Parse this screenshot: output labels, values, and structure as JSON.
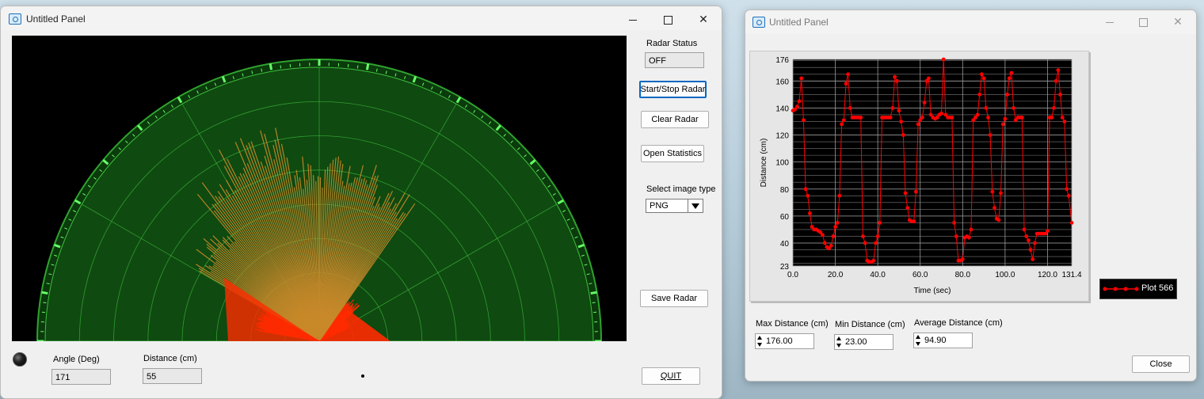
{
  "left_window": {
    "title": "Untitled Panel",
    "radar_status": {
      "label": "Radar Status",
      "value": "OFF"
    },
    "buttons": {
      "start_stop": "Start/Stop Radar",
      "clear": "Clear Radar",
      "statistics": "Open Statistics",
      "save": "Save Radar",
      "quit": "QUIT"
    },
    "image_type": {
      "label": "Select image type",
      "selected": "PNG"
    },
    "angle": {
      "label": "Angle (Deg)",
      "value": "171"
    },
    "distance": {
      "label": "Distance (cm)",
      "value": "55"
    }
  },
  "right_window": {
    "title": "Untitled Panel",
    "max_distance": {
      "label": "Max Distance (cm)",
      "value": "176.00"
    },
    "min_distance": {
      "label": "Min Distance (cm)",
      "value": "23.00"
    },
    "avg_distance": {
      "label": "Average Distance (cm)",
      "value": "94.90"
    },
    "close_label": "Close"
  },
  "colors": {
    "radar_bg": "#000000",
    "radar_field": "#0f4a10",
    "radar_grid": "#3fbf3f",
    "radar_rim": "#2fa32f",
    "radar_tick": "#66ff66",
    "echo_far": "#c98a2a",
    "echo_near": "#ff2a00",
    "plot_bg": "#000000",
    "plot_line": "#ff0000",
    "plot_grid": "#9a9a9a"
  },
  "radar": {
    "echo_angle_range_deg": [
      24,
      171
    ],
    "notes_on_data": "echo lengths per angle, cm"
  },
  "chart_data": {
    "type": "line",
    "xlabel": "Time (sec)",
    "ylabel": "Distance (cm)",
    "xlim": [
      0.0,
      131.4
    ],
    "ylim": [
      23,
      176
    ],
    "x_ticks": [
      "0.0",
      "20.0",
      "40.0",
      "60.0",
      "80.0",
      "100.0",
      "120.0",
      "131.4"
    ],
    "y_ticks": [
      "23",
      "40",
      "60",
      "80",
      "100",
      "120",
      "140",
      "160",
      "176"
    ],
    "grid": true,
    "legend": "right, outside plot area",
    "series": [
      {
        "name": "Plot 566",
        "color": "#ff0000",
        "marker": "circle",
        "points": [
          [
            0.0,
            138
          ],
          [
            1.0,
            139
          ],
          [
            2.0,
            141
          ],
          [
            3.0,
            145
          ],
          [
            4.0,
            162
          ],
          [
            5.0,
            131
          ],
          [
            6.0,
            80
          ],
          [
            7.0,
            75
          ],
          [
            8.0,
            62
          ],
          [
            9.0,
            52
          ],
          [
            10.0,
            50
          ],
          [
            11.0,
            50
          ],
          [
            12.0,
            49
          ],
          [
            13.0,
            48
          ],
          [
            14.0,
            46
          ],
          [
            15.0,
            40
          ],
          [
            16.0,
            37
          ],
          [
            17.0,
            36
          ],
          [
            18.0,
            38
          ],
          [
            19.0,
            45
          ],
          [
            20.0,
            52
          ],
          [
            21.0,
            55
          ],
          [
            22.0,
            75
          ],
          [
            23.0,
            128
          ],
          [
            24.0,
            131
          ],
          [
            25.0,
            158
          ],
          [
            26.0,
            165
          ],
          [
            27.0,
            140
          ],
          [
            28.0,
            133
          ],
          [
            29.0,
            133
          ],
          [
            30.0,
            133
          ],
          [
            31.0,
            133
          ],
          [
            32.0,
            133
          ],
          [
            33.0,
            45
          ],
          [
            34.0,
            40
          ],
          [
            35.0,
            27
          ],
          [
            36.0,
            26
          ],
          [
            37.0,
            26
          ],
          [
            38.0,
            27
          ],
          [
            39.0,
            40
          ],
          [
            40.0,
            45
          ],
          [
            41.0,
            55
          ],
          [
            42.0,
            133
          ],
          [
            43.0,
            133
          ],
          [
            44.0,
            133
          ],
          [
            45.0,
            133
          ],
          [
            46.0,
            133
          ],
          [
            47.0,
            140
          ],
          [
            48.0,
            163
          ],
          [
            49.0,
            160
          ],
          [
            50.0,
            138
          ],
          [
            51.0,
            130
          ],
          [
            52.0,
            120
          ],
          [
            53.0,
            77
          ],
          [
            54.0,
            66
          ],
          [
            55.0,
            57
          ],
          [
            56.0,
            56
          ],
          [
            57.0,
            56
          ],
          [
            58.0,
            78
          ],
          [
            59.0,
            128
          ],
          [
            60.0,
            131
          ],
          [
            61.0,
            133
          ],
          [
            62.0,
            144
          ],
          [
            63.0,
            160
          ],
          [
            64.0,
            162
          ],
          [
            65.0,
            135
          ],
          [
            66.0,
            133
          ],
          [
            67.0,
            132
          ],
          [
            68.0,
            133
          ],
          [
            69.0,
            135
          ],
          [
            70.0,
            136
          ],
          [
            71.0,
            176
          ],
          [
            72.0,
            135
          ],
          [
            73.0,
            133
          ],
          [
            74.0,
            133
          ],
          [
            75.0,
            133
          ],
          [
            76.0,
            55
          ],
          [
            77.0,
            45
          ],
          [
            78.0,
            27
          ],
          [
            79.0,
            27
          ],
          [
            80.0,
            28
          ],
          [
            81.0,
            44
          ],
          [
            82.0,
            45
          ],
          [
            83.0,
            44
          ],
          [
            84.0,
            50
          ],
          [
            85.0,
            131
          ],
          [
            86.0,
            133
          ],
          [
            87.0,
            135
          ],
          [
            88.0,
            150
          ],
          [
            89.0,
            165
          ],
          [
            90.0,
            162
          ],
          [
            91.0,
            140
          ],
          [
            92.0,
            133
          ],
          [
            93.0,
            120
          ],
          [
            94.0,
            78
          ],
          [
            95.0,
            66
          ],
          [
            96.0,
            58
          ],
          [
            97.0,
            57
          ],
          [
            98.0,
            77
          ],
          [
            99.0,
            128
          ],
          [
            100.0,
            132
          ],
          [
            101.0,
            150
          ],
          [
            102.0,
            162
          ],
          [
            103.0,
            166
          ],
          [
            104.0,
            140
          ],
          [
            105.0,
            131
          ],
          [
            106.0,
            133
          ],
          [
            107.0,
            133
          ],
          [
            108.0,
            133
          ],
          [
            109.0,
            50
          ],
          [
            110.0,
            45
          ],
          [
            111.0,
            42
          ],
          [
            112.0,
            35
          ],
          [
            113.0,
            28
          ],
          [
            114.0,
            40
          ],
          [
            115.0,
            47
          ],
          [
            116.0,
            47
          ],
          [
            117.0,
            47
          ],
          [
            118.0,
            47
          ],
          [
            119.0,
            47
          ],
          [
            120.0,
            49
          ],
          [
            121.0,
            133
          ],
          [
            122.0,
            133
          ],
          [
            123.0,
            140
          ],
          [
            124.0,
            160
          ],
          [
            125.0,
            168
          ],
          [
            126.0,
            150
          ],
          [
            127.0,
            133
          ],
          [
            128.0,
            130
          ],
          [
            129.0,
            80
          ],
          [
            130.0,
            75
          ],
          [
            131.4,
            55
          ]
        ]
      }
    ]
  }
}
